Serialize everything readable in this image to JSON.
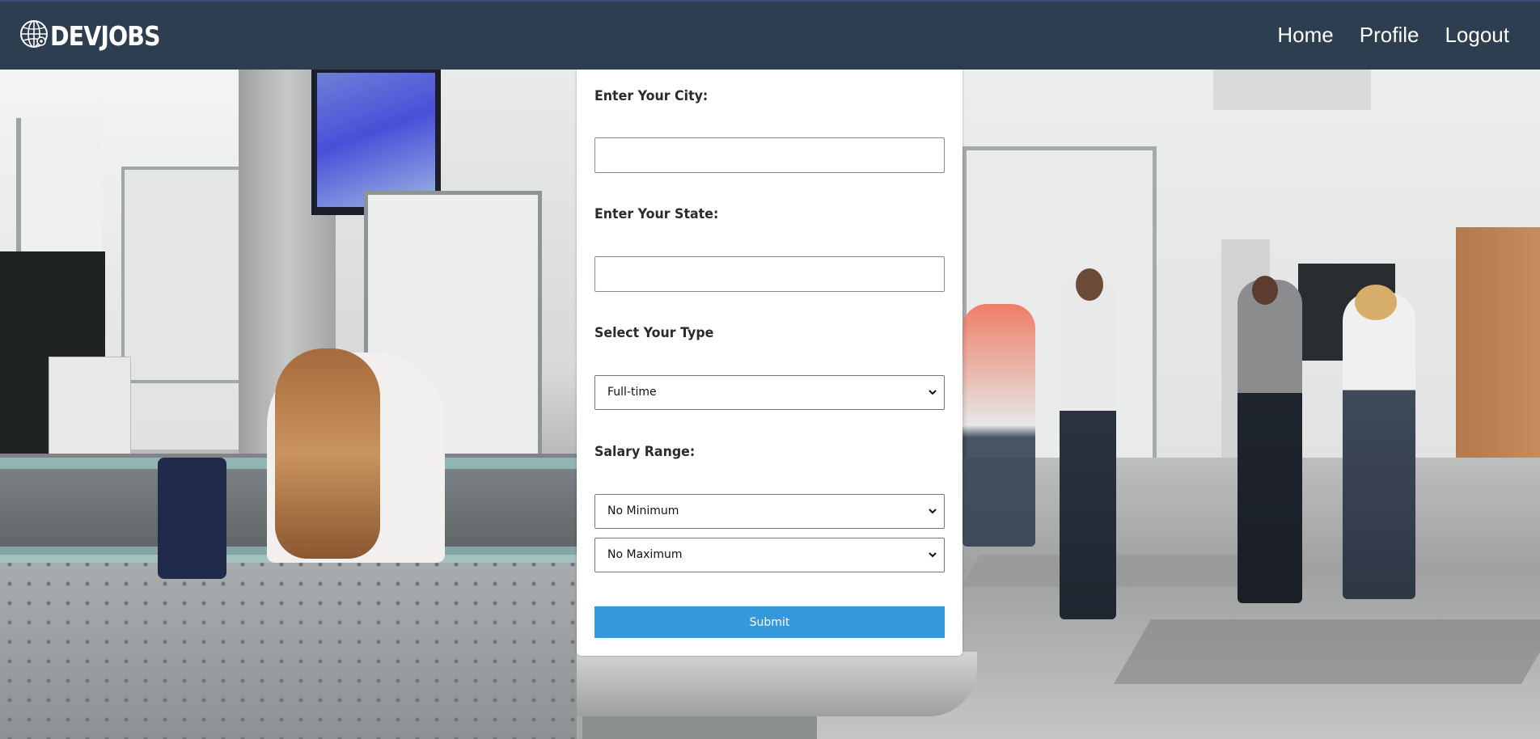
{
  "navbar": {
    "brand": "DEVJOBS",
    "brand_icon": "globe-gear-icon",
    "links": [
      "Home",
      "Profile",
      "Logout"
    ]
  },
  "form": {
    "city_label": "Enter Your City:",
    "city_value": "",
    "state_label": "Enter Your State:",
    "state_value": "",
    "type_label": "Select Your Type",
    "type_selected": "Full-time",
    "salary_label": "Salary Range:",
    "salary_min_selected": "No Minimum",
    "salary_max_selected": "No Maximum",
    "submit_label": "Submit"
  },
  "colors": {
    "navbar_bg": "#2c3e50",
    "submit_bg": "#3498db",
    "card_bg": "#ffffff"
  }
}
